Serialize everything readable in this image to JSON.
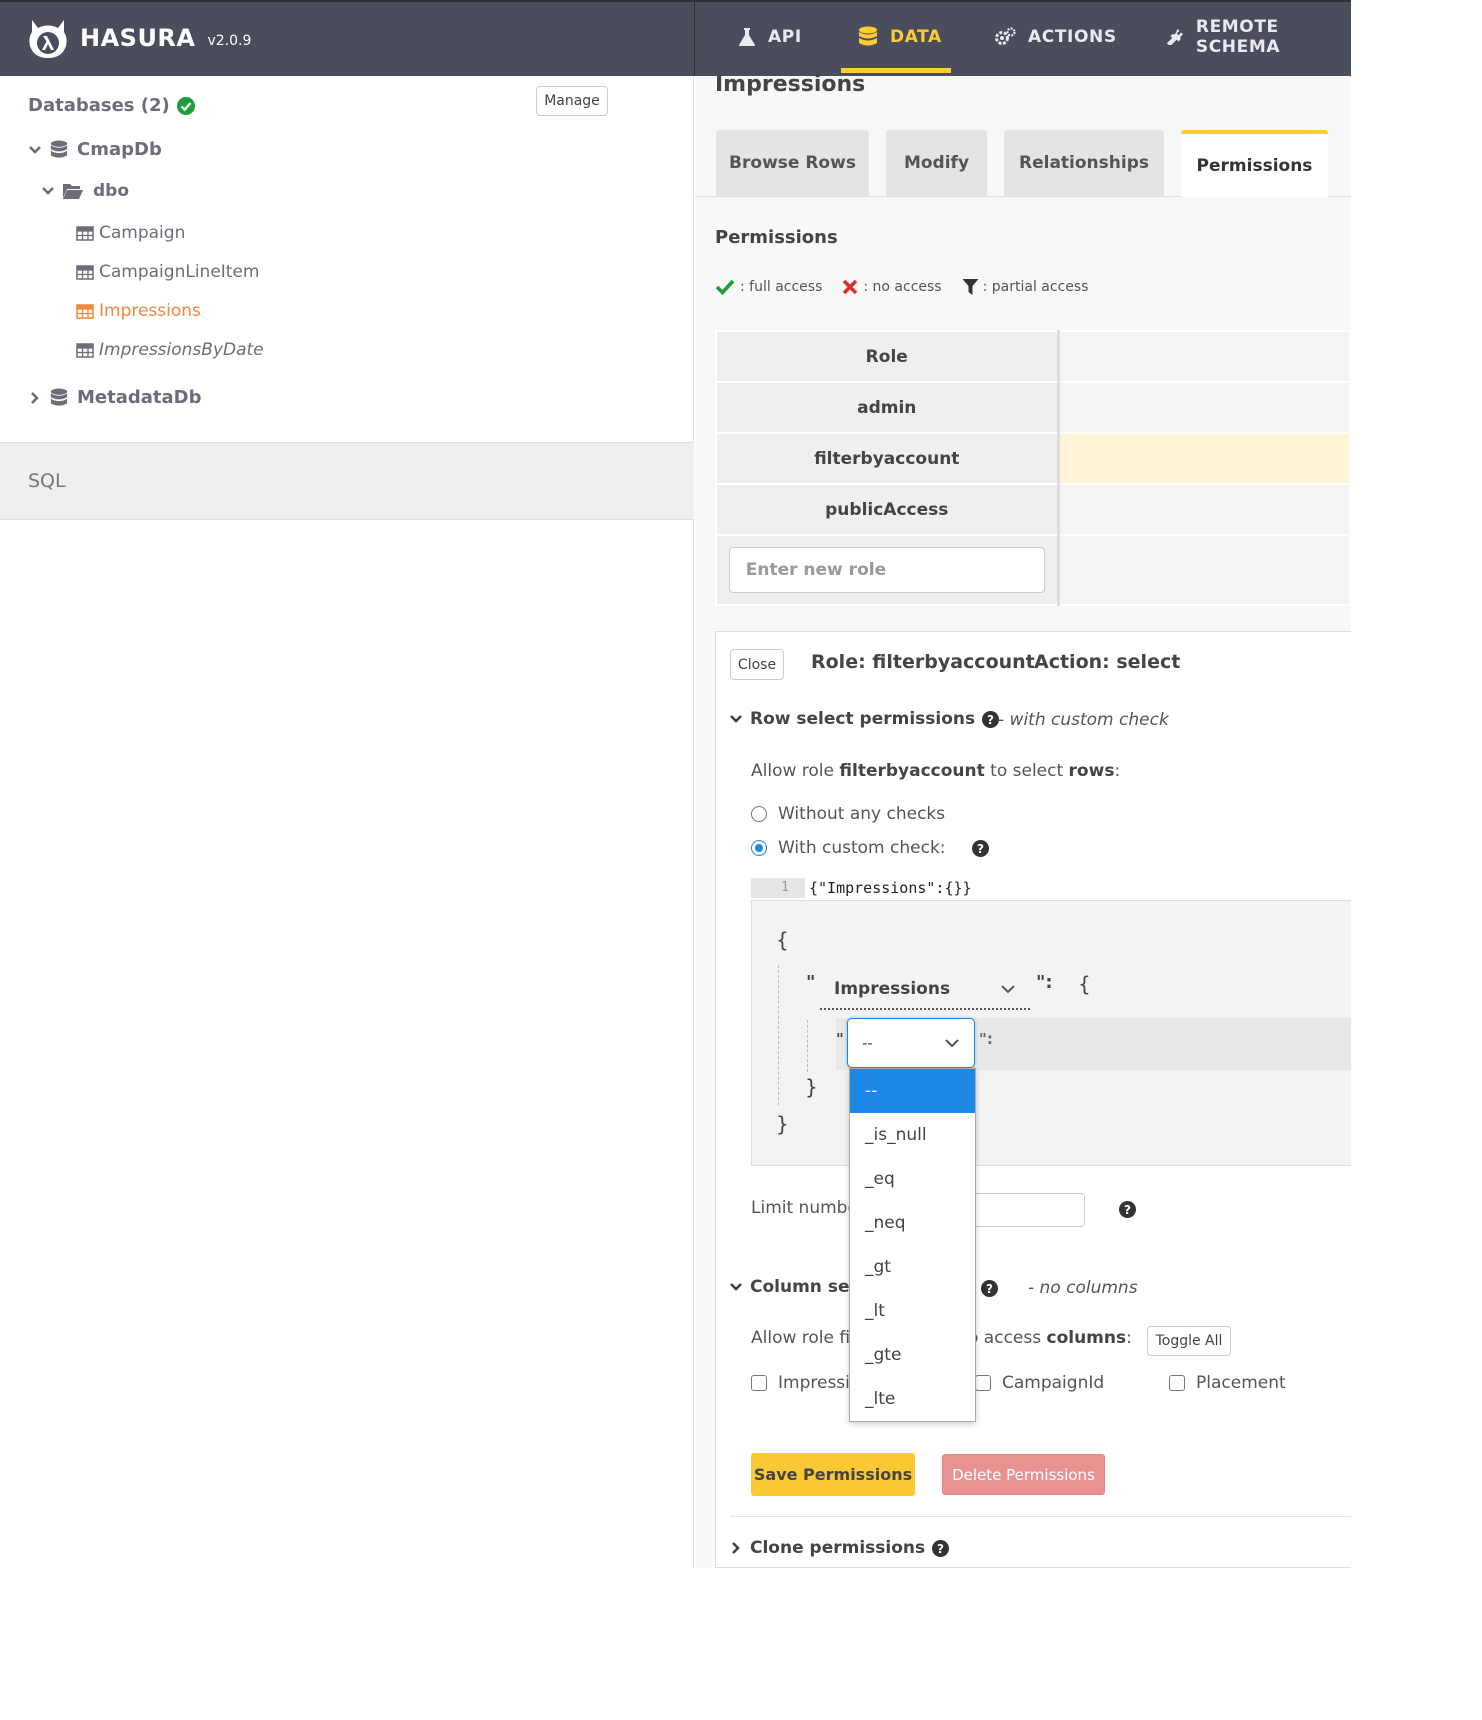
{
  "brand": {
    "name": "HASURA",
    "version": "v2.0.9",
    "accent": "#ffcc33"
  },
  "nav": [
    {
      "label": "API",
      "icon": "flask-icon",
      "active": false
    },
    {
      "label": "DATA",
      "icon": "database-icon",
      "active": true
    },
    {
      "label": "ACTIONS",
      "icon": "gears-icon",
      "active": false
    },
    {
      "label": "REMOTE SCHEMA",
      "icon": "plug-icon",
      "active": false
    }
  ],
  "sidebar": {
    "databases_label": "Databases (2)",
    "manage_label": "Manage",
    "tree": {
      "db1": "CmapDb",
      "schema": "dbo",
      "tables": [
        "Campaign",
        "CampaignLineItem",
        "Impressions",
        "ImpressionsByDate"
      ],
      "db2": "MetadataDb"
    },
    "sql_label": "SQL"
  },
  "main": {
    "title": "Impressions",
    "tabs": [
      "Browse Rows",
      "Modify",
      "Relationships",
      "Permissions"
    ],
    "permissions_heading": "Permissions",
    "legend": {
      "full": ": full access",
      "none": ": no access",
      "partial": ": partial access"
    },
    "role_table": {
      "header": "Role",
      "roles": [
        "admin",
        "filterbyaccount",
        "publicAccess"
      ],
      "new_role_placeholder": "Enter new role"
    }
  },
  "editor": {
    "close_label": "Close",
    "role_label": "Role: filterbyaccount",
    "action_label": "Action: select",
    "row_section": {
      "title": "Row select permissions",
      "note": "- with custom check"
    },
    "allow_prefix": "Allow role ",
    "allow_role": "filterbyaccount",
    "allow_mid": " to select ",
    "allow_rows": "rows",
    "allow_suffix": ":",
    "radio_without": "Without any checks",
    "radio_with": "With custom check:",
    "code_line_number": "1",
    "code_text": "{\"Impressions\":{}}",
    "builder": {
      "open_brace": "{",
      "column_quote_open": "\"",
      "column": "Impressions",
      "column_quote_close": "\":",
      "inner_brace": "{",
      "op_quote_open": "\"",
      "operator_selected": "--",
      "op_quote_close": "\":",
      "close_inner": "}",
      "close_outer": "}"
    },
    "operators": [
      "--",
      "_is_null",
      "_eq",
      "_neq",
      "_gt",
      "_lt",
      "_gte",
      "_lte"
    ],
    "limit_label": "Limit numbe",
    "column_section": {
      "title": "Column sele",
      "note": "- no columns"
    },
    "col_allow_prefix": "Allow role fi",
    "col_allow_suffix_a": "o access ",
    "col_allow_suffix_b": "columns",
    "col_allow_suffix_c": ":",
    "toggle_all_label": "Toggle All",
    "columns": [
      "Impressi",
      "CampaignId",
      "Placement"
    ],
    "save_label": "Save Permissions",
    "delete_label": "Delete Permissions",
    "clone_label": "Clone permissions"
  }
}
